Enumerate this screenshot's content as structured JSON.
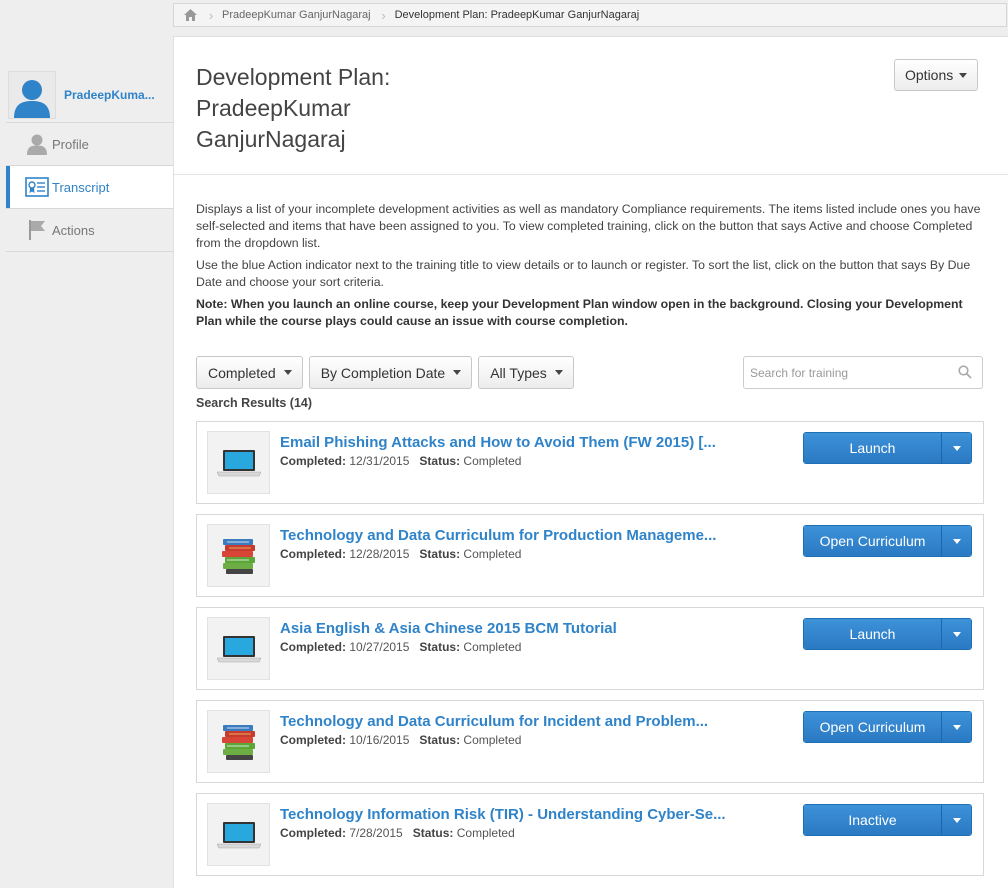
{
  "breadcrumb": {
    "items": [
      "PradeepKumar GanjurNagaraj",
      "Development Plan: PradeepKumar GanjurNagaraj"
    ]
  },
  "sidebar": {
    "user_name": "PradeepKuma...",
    "items": [
      {
        "label": "Profile",
        "icon": "person-icon"
      },
      {
        "label": "Transcript",
        "icon": "transcript-icon"
      },
      {
        "label": "Actions",
        "icon": "flag-icon"
      }
    ]
  },
  "page": {
    "title_lines": [
      "Development Plan:",
      "PradeepKumar",
      "GanjurNagaraj"
    ],
    "options_label": "Options",
    "description": [
      "Displays a list of your incomplete development activities as well as mandatory Compliance requirements.  The items listed include ones you have self-selected and items that have been assigned to you. To view completed training, click on the button that says Active and choose Completed from the dropdown list.",
      "Use the blue Action indicator next to the training title to view details or to launch or register. To sort the list, click on the button that says By Due Date and choose your sort criteria."
    ],
    "note": "Note: When you launch an online course, keep your Development Plan window open in the background. Closing your Development Plan while the course plays could cause an issue with course completion."
  },
  "filters": {
    "status": "Completed",
    "sort": "By Completion Date",
    "type": "All Types",
    "search_placeholder": "Search for training"
  },
  "results_label": "Search Results (14)",
  "results": [
    {
      "title": "Email Phishing Attacks and How to Avoid Them (FW 2015) [...",
      "completed_label": "Completed:",
      "completed": "12/31/2015",
      "status_label": "Status:",
      "status": "Completed",
      "action": "Launch",
      "icon": "laptop-icon"
    },
    {
      "title": "Technology and Data Curriculum for Production Manageme...",
      "completed_label": "Completed:",
      "completed": "12/28/2015",
      "status_label": "Status:",
      "status": "Completed",
      "action": "Open Curriculum",
      "icon": "books-icon"
    },
    {
      "title": "Asia English & Asia Chinese 2015 BCM Tutorial",
      "completed_label": "Completed:",
      "completed": "10/27/2015",
      "status_label": "Status:",
      "status": "Completed",
      "action": "Launch",
      "icon": "laptop-icon"
    },
    {
      "title": "Technology and Data Curriculum for Incident and Problem...",
      "completed_label": "Completed:",
      "completed": "10/16/2015",
      "status_label": "Status:",
      "status": "Completed",
      "action": "Open Curriculum",
      "icon": "books-icon"
    },
    {
      "title": "Technology Information Risk (TIR) - Understanding Cyber-Se...",
      "completed_label": "Completed:",
      "completed": "7/28/2015",
      "status_label": "Status:",
      "status": "Completed",
      "action": "Inactive",
      "icon": "laptop-icon"
    }
  ],
  "colors": {
    "accent": "#2f83c9",
    "button_blue": "#2a79c3",
    "background": "#eeeeee"
  }
}
